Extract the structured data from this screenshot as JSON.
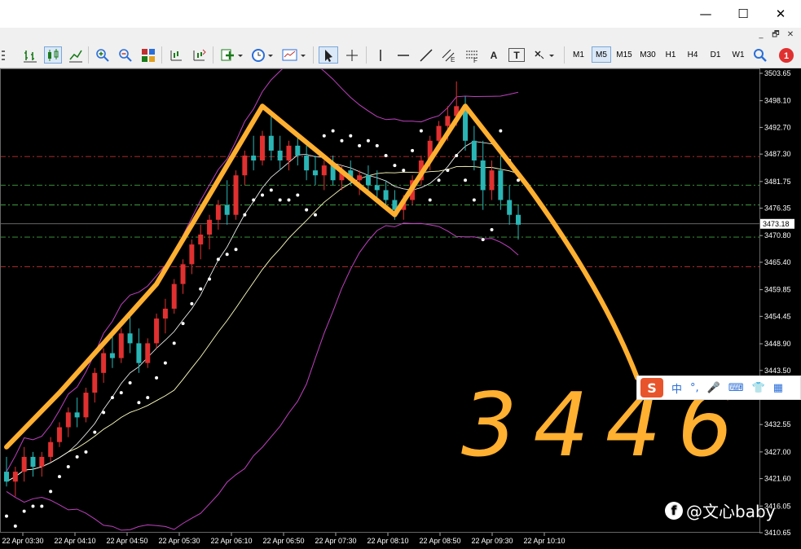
{
  "window": {
    "minimize_glyph": "—",
    "maximize_glyph": "☐",
    "close_glyph": "✕",
    "mdi_minimize": "_",
    "mdi_restore": "🗗",
    "mdi_close": "✕"
  },
  "toolbar": {
    "timeframes": [
      "M1",
      "M5",
      "M15",
      "M30",
      "H1",
      "H4",
      "D1",
      "W1"
    ],
    "selected_timeframe": "M5",
    "notification_count": "1",
    "text_tool_label": "A",
    "textlabel_tool_label": "T"
  },
  "colors": {
    "background": "#000000",
    "bull_candle": "#e03030",
    "bear_candle": "#2ab5b5",
    "bollinger": "#c040c0",
    "moving_average": "#ffffc0",
    "parabolic_sar": "#ffffff",
    "annotation": "#ffb030",
    "level_red": "#c03030",
    "level_green": "#40a040",
    "grid": "#202020"
  },
  "chart_data": {
    "type": "candlestick",
    "symbol_timeframe": "M5",
    "current_price": "3473.18",
    "ylim": [
      3410.65,
      3503.65
    ],
    "price_axis_labels": [
      "3503.65",
      "3498.10",
      "3492.70",
      "3487.30",
      "3481.75",
      "3476.35",
      "3470.80",
      "3465.40",
      "3459.85",
      "3454.45",
      "3448.90",
      "3443.50",
      "3438.10",
      "3432.55",
      "3427.00",
      "3421.60",
      "3416.05",
      "3410.65"
    ],
    "time_axis_labels": [
      "22 Apr 03:30",
      "22 Apr 04:10",
      "22 Apr 04:50",
      "22 Apr 05:30",
      "22 Apr 06:10",
      "22 Apr 06:50",
      "22 Apr 07:30",
      "22 Apr 08:10",
      "22 Apr 08:50",
      "22 Apr 09:30",
      "22 Apr 10:10"
    ],
    "horizontal_levels": [
      {
        "price": 3486.8,
        "color": "red"
      },
      {
        "price": 3481.0,
        "color": "green"
      },
      {
        "price": 3477.0,
        "color": "green"
      },
      {
        "price": 3470.5,
        "color": "green"
      },
      {
        "price": 3464.5,
        "color": "red"
      }
    ],
    "candles": [
      [
        3423,
        3426,
        3420,
        3421
      ],
      [
        3421,
        3424,
        3418,
        3423
      ],
      [
        3423,
        3428,
        3421,
        3426
      ],
      [
        3426,
        3427,
        3422,
        3424
      ],
      [
        3424,
        3427,
        3422,
        3426
      ],
      [
        3426,
        3430,
        3425,
        3429
      ],
      [
        3429,
        3433,
        3428,
        3432
      ],
      [
        3432,
        3436,
        3430,
        3435
      ],
      [
        3435,
        3438,
        3432,
        3434
      ],
      [
        3434,
        3440,
        3433,
        3439
      ],
      [
        3439,
        3444,
        3437,
        3443
      ],
      [
        3443,
        3448,
        3441,
        3447
      ],
      [
        3447,
        3451,
        3444,
        3446
      ],
      [
        3446,
        3452,
        3445,
        3451
      ],
      [
        3451,
        3455,
        3447,
        3449
      ],
      [
        3449,
        3452,
        3443,
        3445
      ],
      [
        3445,
        3450,
        3444,
        3449
      ],
      [
        3449,
        3455,
        3448,
        3454
      ],
      [
        3454,
        3458,
        3451,
        3456
      ],
      [
        3456,
        3462,
        3455,
        3461
      ],
      [
        3461,
        3466,
        3459,
        3465
      ],
      [
        3465,
        3470,
        3463,
        3469
      ],
      [
        3469,
        3473,
        3466,
        3471
      ],
      [
        3471,
        3475,
        3468,
        3474
      ],
      [
        3474,
        3478,
        3472,
        3477
      ],
      [
        3477,
        3482,
        3473,
        3475
      ],
      [
        3475,
        3484,
        3474,
        3483
      ],
      [
        3483,
        3488,
        3481,
        3487
      ],
      [
        3487,
        3491,
        3484,
        3486
      ],
      [
        3486,
        3492,
        3485,
        3491
      ],
      [
        3491,
        3495,
        3486,
        3488
      ],
      [
        3488,
        3491,
        3484,
        3486
      ],
      [
        3486,
        3490,
        3484,
        3489
      ],
      [
        3489,
        3491,
        3485,
        3487
      ],
      [
        3487,
        3489,
        3482,
        3484
      ],
      [
        3484,
        3487,
        3481,
        3483
      ],
      [
        3483,
        3486,
        3480,
        3485
      ],
      [
        3485,
        3487,
        3481,
        3482
      ],
      [
        3482,
        3485,
        3480,
        3484
      ],
      [
        3484,
        3486,
        3481,
        3482
      ],
      [
        3482,
        3484,
        3479,
        3483
      ],
      [
        3483,
        3485,
        3480,
        3481
      ],
      [
        3481,
        3484,
        3478,
        3480
      ],
      [
        3480,
        3482,
        3476,
        3478
      ],
      [
        3478,
        3480,
        3474,
        3476
      ],
      [
        3476,
        3479,
        3474,
        3478
      ],
      [
        3478,
        3483,
        3477,
        3482
      ],
      [
        3482,
        3487,
        3481,
        3486
      ],
      [
        3486,
        3491,
        3484,
        3490
      ],
      [
        3490,
        3494,
        3488,
        3493
      ],
      [
        3493,
        3497,
        3490,
        3495
      ],
      [
        3495,
        3502,
        3493,
        3497
      ],
      [
        3497,
        3499,
        3488,
        3490
      ],
      [
        3490,
        3493,
        3484,
        3486
      ],
      [
        3486,
        3490,
        3476,
        3480
      ],
      [
        3480,
        3486,
        3478,
        3484
      ],
      [
        3484,
        3487,
        3476,
        3478
      ],
      [
        3478,
        3481,
        3473,
        3475
      ],
      [
        3475,
        3477,
        3470,
        3473
      ]
    ],
    "annotation_text": "3446",
    "watermark": "@文心baby"
  },
  "ime_bar": {
    "logo": "S",
    "mode": "中",
    "punct": "°,"
  }
}
